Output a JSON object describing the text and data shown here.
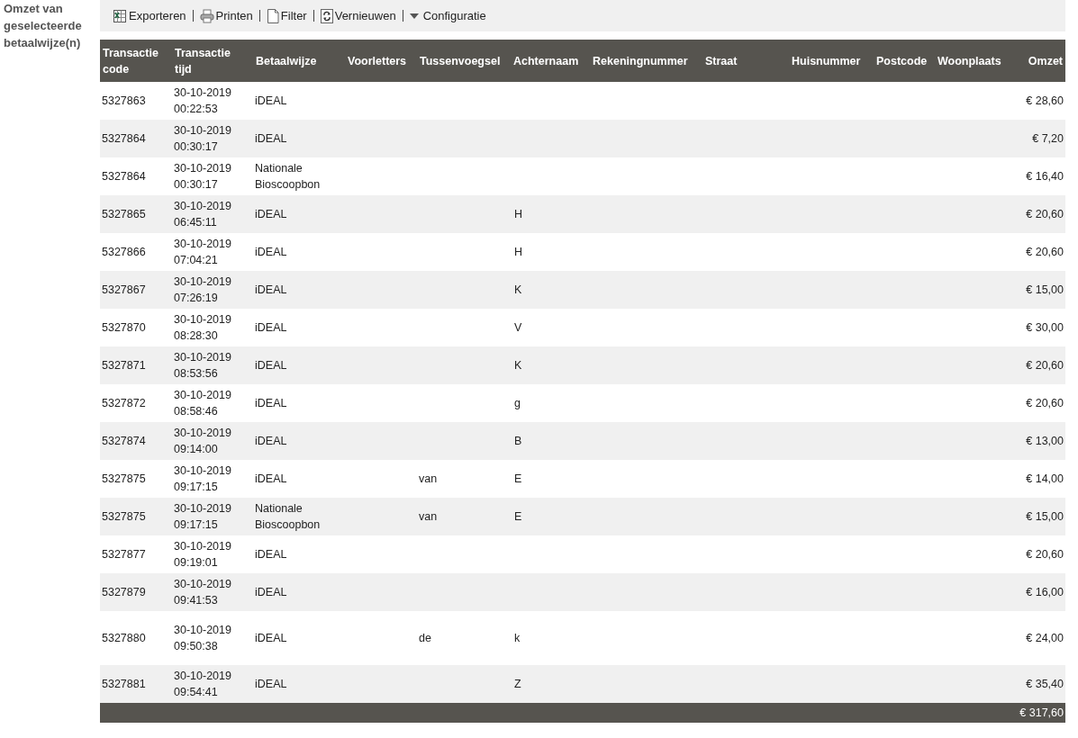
{
  "side_title": "Omzet van geselecteerde betaalwijze(n)",
  "toolbar": [
    {
      "kind": "export",
      "label": "Exporteren"
    },
    {
      "kind": "print",
      "label": "Printen"
    },
    {
      "kind": "filter",
      "label": "Filter"
    },
    {
      "kind": "refresh",
      "label": "Vernieuwen"
    },
    {
      "kind": "config",
      "label": "Configuratie"
    }
  ],
  "table": {
    "columns": [
      "Transactie code",
      "Transactie tijd",
      "Betaalwijze",
      "Voorletters",
      "Tussenvoegsel",
      "Achternaam",
      "Rekeningnummer",
      "Straat",
      "Huisnummer",
      "Postcode",
      "Woonplaats",
      "Omzet"
    ],
    "rows": [
      {
        "code": "5327863",
        "time": "30-10-2019 00:22:53",
        "payment": "iDEAL",
        "amount": "€ 28,60"
      },
      {
        "code": "5327864",
        "time": "30-10-2019 00:30:17",
        "payment": "iDEAL",
        "amount": "€ 7,20"
      },
      {
        "code": "5327864",
        "time": "30-10-2019 00:30:17",
        "payment": "Nationale Bioscoopbon",
        "amount": "€ 16,40"
      },
      {
        "code": "5327865",
        "time": "30-10-2019 06:45:11",
        "payment": "iDEAL",
        "surname": "H",
        "amount": "€ 20,60"
      },
      {
        "code": "5327866",
        "time": "30-10-2019 07:04:21",
        "payment": "iDEAL",
        "surname": "H",
        "amount": "€ 20,60"
      },
      {
        "code": "5327867",
        "time": "30-10-2019 07:26:19",
        "payment": "iDEAL",
        "surname": "K",
        "amount": "€ 15,00"
      },
      {
        "code": "5327870",
        "time": "30-10-2019 08:28:30",
        "payment": "iDEAL",
        "surname": "V",
        "amount": "€ 30,00"
      },
      {
        "code": "5327871",
        "time": "30-10-2019 08:53:56",
        "payment": "iDEAL",
        "surname": "K",
        "amount": "€ 20,60"
      },
      {
        "code": "5327872",
        "time": "30-10-2019 08:58:46",
        "payment": "iDEAL",
        "surname": "g",
        "amount": "€ 20,60"
      },
      {
        "code": "5327874",
        "time": "30-10-2019 09:14:00",
        "payment": "iDEAL",
        "surname": "B",
        "amount": "€ 13,00"
      },
      {
        "code": "5327875",
        "time": "30-10-2019 09:17:15",
        "payment": "iDEAL",
        "infix": "van",
        "surname": "E",
        "amount": "€ 14,00"
      },
      {
        "code": "5327875",
        "time": "30-10-2019 09:17:15",
        "payment": "Nationale Bioscoopbon",
        "infix": "van",
        "surname": "E",
        "amount": "€ 15,00"
      },
      {
        "code": "5327877",
        "time": "30-10-2019 09:19:01",
        "payment": "iDEAL",
        "amount": "€ 20,60"
      },
      {
        "code": "5327879",
        "time": "30-10-2019 09:41:53",
        "payment": "iDEAL",
        "amount": "€ 16,00"
      },
      {
        "code": "5327880",
        "time": "30-10-2019 09:50:38",
        "payment": "iDEAL",
        "infix": "de",
        "surname": "k",
        "amount": "€ 24,00"
      },
      {
        "code": "5327881",
        "time": "30-10-2019 09:54:41",
        "payment": "iDEAL",
        "surname": "Z",
        "amount": "€ 35,40"
      }
    ],
    "total": "€ 317,60"
  }
}
